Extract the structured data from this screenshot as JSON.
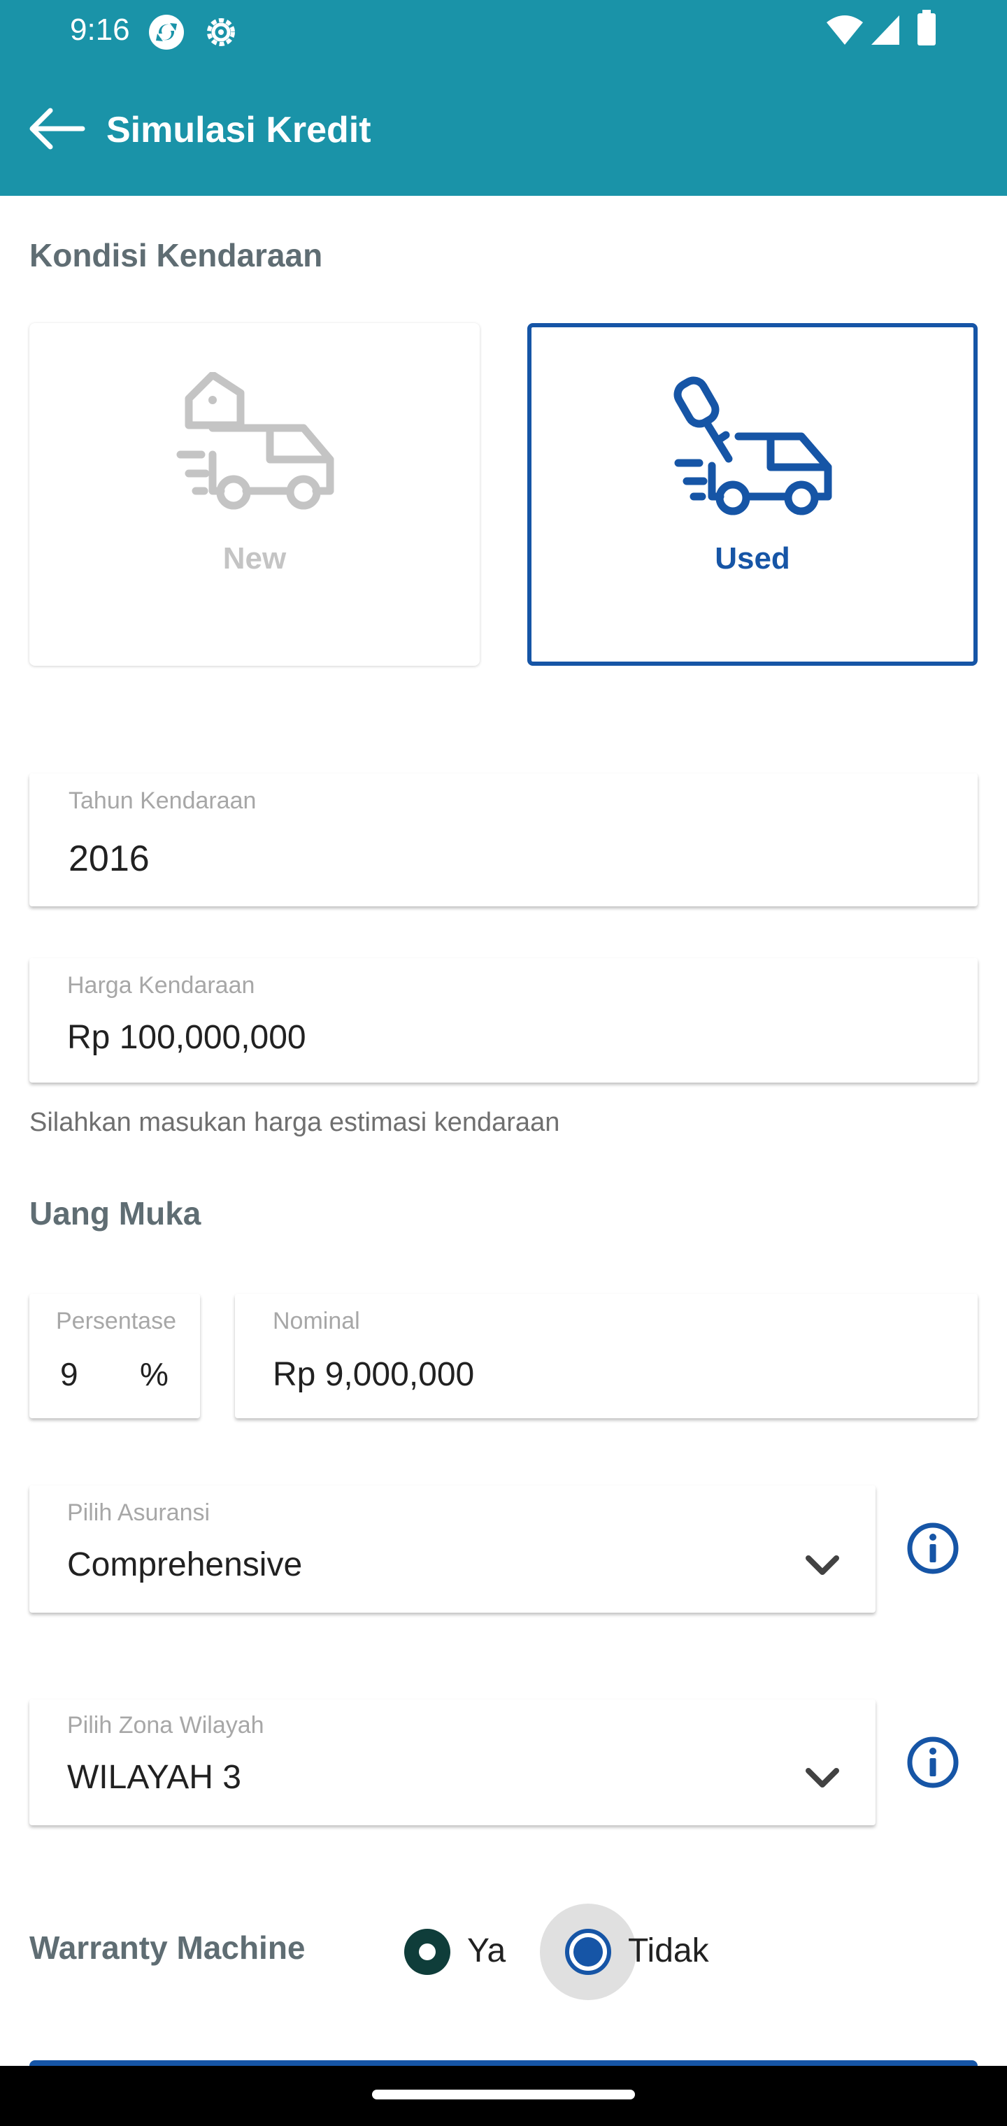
{
  "status_bar": {
    "time": "9:16"
  },
  "app_bar": {
    "title": "Simulasi Kredit"
  },
  "vehicle_condition": {
    "title": "Kondisi Kendaraan",
    "options": [
      {
        "label": "New",
        "selected": false
      },
      {
        "label": "Used",
        "selected": true
      }
    ]
  },
  "vehicle_year": {
    "label": "Tahun Kendaraan",
    "value": "2016"
  },
  "vehicle_price": {
    "label": "Harga Kendaraan",
    "value": "Rp 100,000,000",
    "helper": "Silahkan masukan harga estimasi kendaraan"
  },
  "down_payment": {
    "title": "Uang Muka",
    "percentage": {
      "label": "Persentase",
      "value": "9",
      "suffix": "%"
    },
    "nominal": {
      "label": "Nominal",
      "value": "Rp 9,000,000"
    }
  },
  "insurance": {
    "label": "Pilih Asuransi",
    "value": "Comprehensive"
  },
  "zone": {
    "label": "Pilih Zona Wilayah",
    "value": "WILAYAH 3"
  },
  "warranty": {
    "label": "Warranty Machine",
    "options": [
      {
        "label": "Ya",
        "selected": false
      },
      {
        "label": "Tidak",
        "selected": true
      }
    ]
  },
  "colors": {
    "primary": "#1a93a8",
    "accent_blue": "#1655a6",
    "radio_dark": "#0f3d3a"
  },
  "icons": [
    "back-arrow-icon",
    "new-car-tag-icon",
    "used-car-key-icon",
    "info-icon",
    "chevron-down-icon"
  ]
}
